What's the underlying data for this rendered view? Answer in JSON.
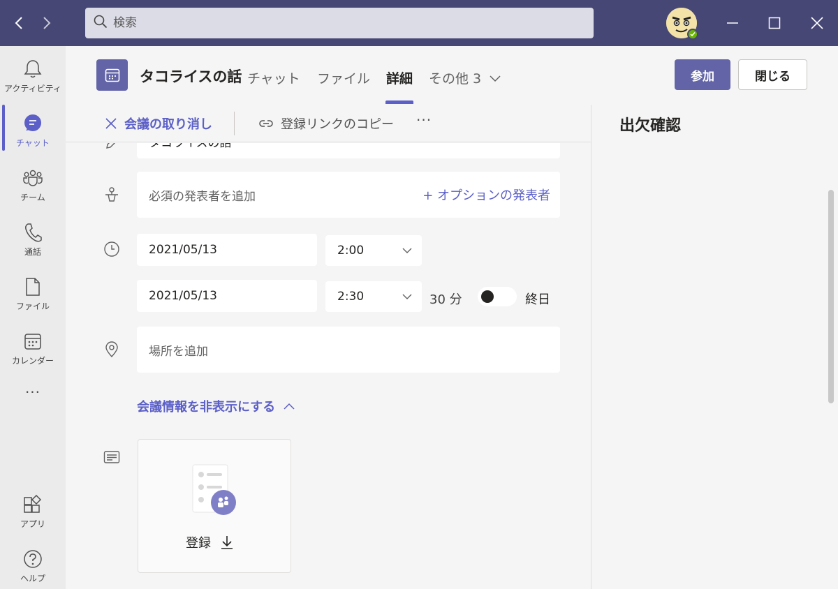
{
  "titlebar": {
    "search_placeholder": "検索"
  },
  "rail": {
    "items": [
      {
        "label": "アクティビティ",
        "icon": "bell-icon"
      },
      {
        "label": "チャット",
        "icon": "chat-icon"
      },
      {
        "label": "チーム",
        "icon": "teams-icon"
      },
      {
        "label": "通話",
        "icon": "phone-icon"
      },
      {
        "label": "ファイル",
        "icon": "file-icon"
      },
      {
        "label": "カレンダー",
        "icon": "calendar-icon"
      },
      {
        "label": "アプリ",
        "icon": "apps-icon"
      },
      {
        "label": "ヘルプ",
        "icon": "help-icon"
      }
    ],
    "more": "···"
  },
  "header": {
    "title": "タコライスの話",
    "tabs": [
      {
        "label": "チャット"
      },
      {
        "label": "ファイル"
      },
      {
        "label": "詳細"
      },
      {
        "label": "その他 3"
      }
    ],
    "join_label": "参加",
    "close_label": "閉じる"
  },
  "toolbar": {
    "cancel_label": "会議の取り消し",
    "copy_label": "登録リンクのコピー",
    "more": "···"
  },
  "form": {
    "title_value": "タコライスの話",
    "presenter_placeholder": "必須の発表者を追加",
    "optional_presenter": "+ オプションの発表者",
    "start_date": "2021/05/13",
    "start_time": "2:00",
    "end_date": "2021/05/13",
    "end_time": "2:30",
    "duration": "30 分",
    "allday_label": "終日",
    "location_placeholder": "場所を追加",
    "hide_info_label": "会議情報を非表示にする",
    "registration_label": "登録"
  },
  "right_panel": {
    "title": "出欠確認"
  },
  "colors": {
    "titlebar": "#464775",
    "accent": "#5b5fc7",
    "button": "#6264a7"
  }
}
